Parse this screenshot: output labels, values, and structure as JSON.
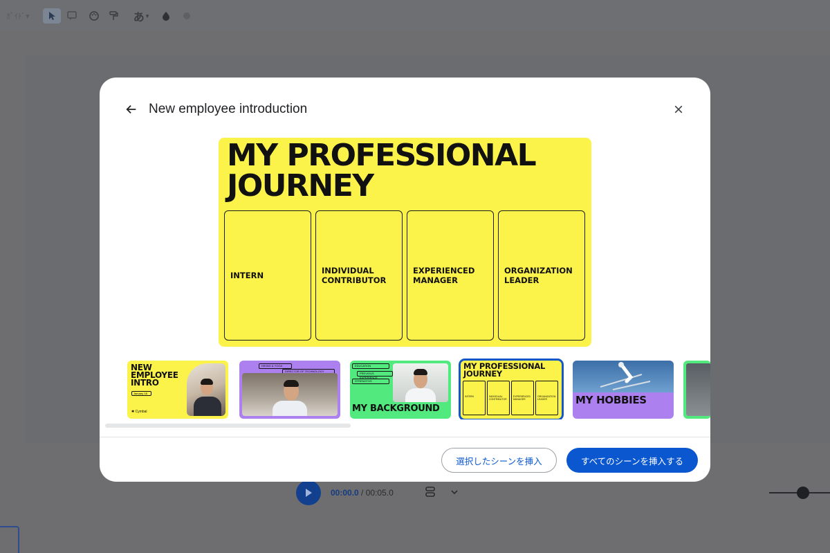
{
  "toolbar": {
    "zoom_label": "ｶﾞｲﾄﾞ▾",
    "text_tool_label": "あ",
    "text_tool_caret": "▾",
    "icons": [
      "select-cursor-icon",
      "comment-icon",
      "palette-icon",
      "format-paint-icon",
      "text-style-icon",
      "fill-drop-icon",
      "brush-icon"
    ]
  },
  "player": {
    "current_time": "00:00.0",
    "separator": " / ",
    "duration": "00:05.0"
  },
  "dialog": {
    "title": "New employee introduction",
    "preview": {
      "title": "MY PROFESSIONAL JOURNEY",
      "stages": [
        "INTERN",
        "INDIVIDUAL CONTRIBUTOR",
        "EXPERIENCED MANAGER",
        "ORGANIZATION LEADER"
      ]
    },
    "thumbnails": [
      {
        "title": "NEW EMPLOYEE INTRO",
        "date": "January 18",
        "brand": "✱ Cymbal",
        "color": "#fcf34a"
      },
      {
        "labels": [
          "HIKING & YOGA",
          "DIRECTOR OF TECHNOLOGY"
        ],
        "color": "#ad80f0"
      },
      {
        "labels": [
          "EDUCATION",
          "PREVIOUS EXPERIENCE",
          "STRENGTHS"
        ],
        "caption": "MY BACKGROUND",
        "color": "#52e97e"
      },
      {
        "title": "MY PROFESSIONAL JOURNEY",
        "stages": [
          "INTERN",
          "INDIVIDUAL CONTRIBUTOR",
          "EXPERIENCED MANAGER",
          "ORGANIZATION LEADER"
        ],
        "color": "#fcf34a",
        "selected": true
      },
      {
        "caption": "MY HOBBIES",
        "color": "#ad80f0"
      },
      {
        "color": "#52e97e"
      }
    ],
    "buttons": {
      "insert_selected": "選択したシーンを挿入",
      "insert_all": "すべてのシーンを挿入する"
    }
  },
  "colors": {
    "accent": "#0b57d0",
    "slide_yellow": "#fcf34a",
    "slide_purple": "#ad80f0",
    "slide_green": "#52e97e",
    "overlay": "#6e6e70"
  }
}
